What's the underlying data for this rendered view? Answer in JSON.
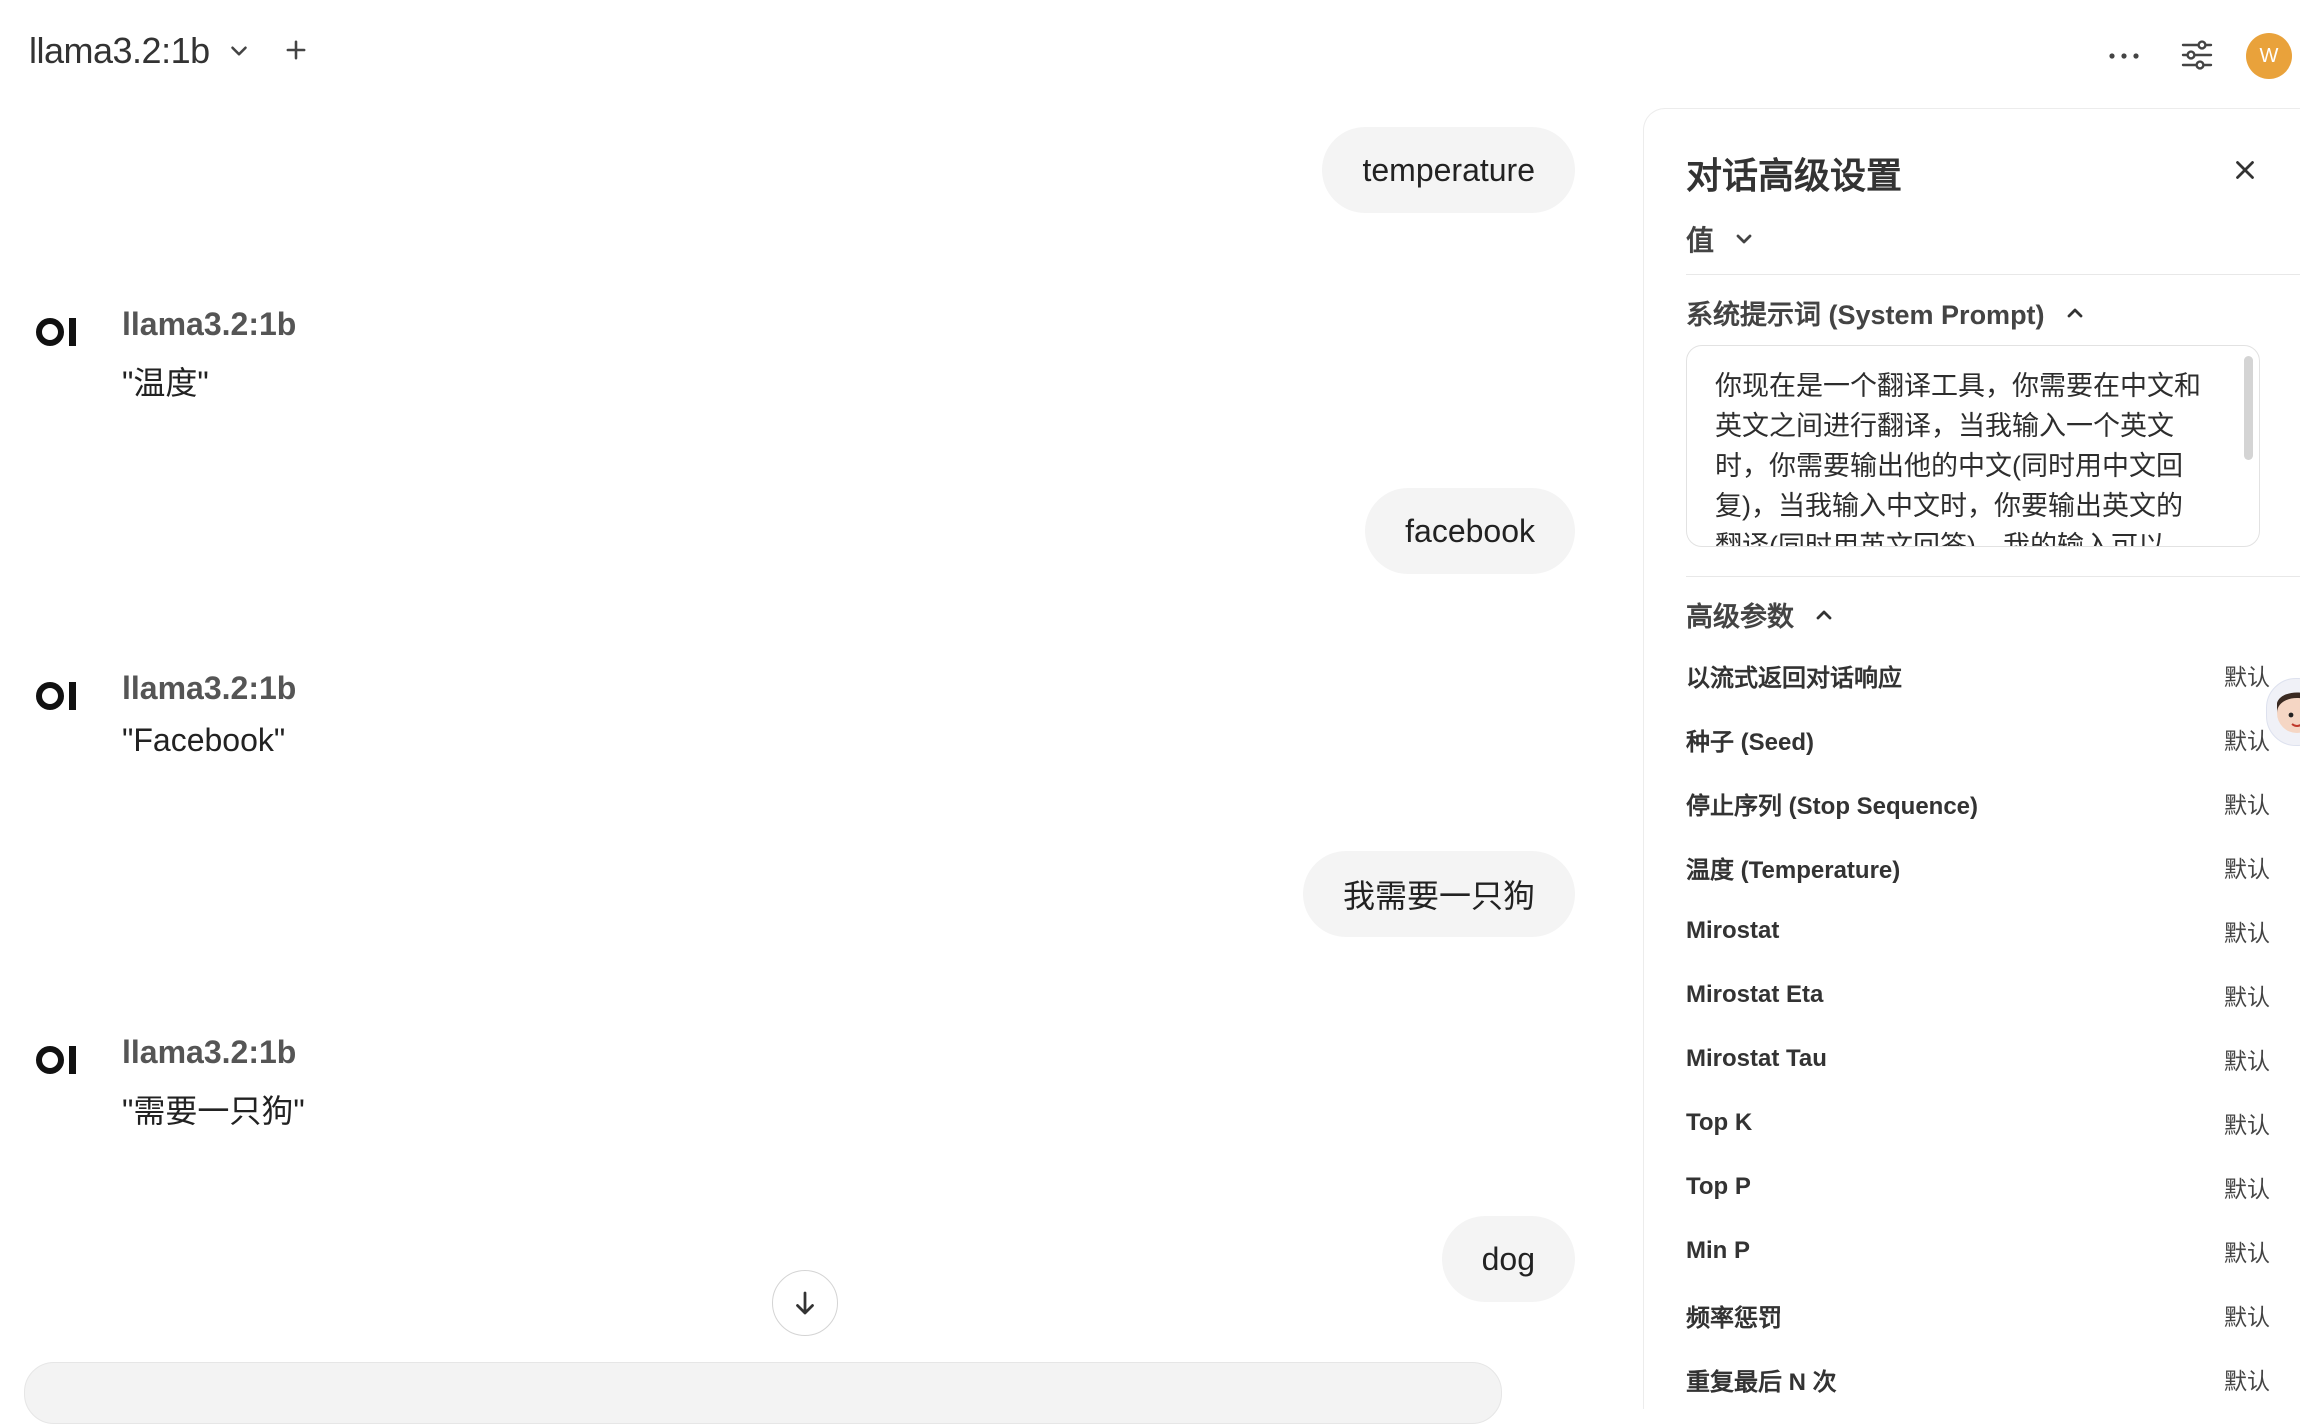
{
  "header": {
    "model_name": "llama3.2:1b",
    "avatar_initial": "W",
    "avatar_color": "#e9a23b"
  },
  "chat": {
    "messages": [
      {
        "role": "user",
        "text": "temperature"
      },
      {
        "role": "assistant",
        "name": "llama3.2:1b",
        "text": "\"温度\""
      },
      {
        "role": "user",
        "text": "facebook"
      },
      {
        "role": "assistant",
        "name": "llama3.2:1b",
        "text": "\"Facebook\""
      },
      {
        "role": "user",
        "text": "我需要一只狗"
      },
      {
        "role": "assistant",
        "name": "llama3.2:1b",
        "text": "\"需要一只狗\""
      },
      {
        "role": "user",
        "text": "dog"
      }
    ]
  },
  "panel": {
    "title": "对话高级设置",
    "value_dropdown": "值",
    "system_prompt_header": "系统提示词 (System Prompt)",
    "system_prompt_text": "你现在是一个翻译工具，你需要在中文和英文之间进行翻译，当我输入一个英文时，你需要输出他的中文(同时用中文回复)，当我输入中文时，你要输出英文的翻译(同时用英文回答)，我的输入可以",
    "advanced_header": "高级参数",
    "params": [
      {
        "label": "以流式返回对话响应",
        "value": "默认"
      },
      {
        "label": "种子 (Seed)",
        "value": "默认"
      },
      {
        "label": "停止序列 (Stop Sequence)",
        "value": "默认"
      },
      {
        "label": "温度 (Temperature)",
        "value": "默认"
      },
      {
        "label": "Mirostat",
        "value": "默认"
      },
      {
        "label": "Mirostat Eta",
        "value": "默认"
      },
      {
        "label": "Mirostat Tau",
        "value": "默认"
      },
      {
        "label": "Top K",
        "value": "默认"
      },
      {
        "label": "Top P",
        "value": "默认"
      },
      {
        "label": "Min P",
        "value": "默认"
      },
      {
        "label": "频率惩罚",
        "value": "默认"
      },
      {
        "label": "重复最后 N 次",
        "value": "默认"
      }
    ]
  }
}
